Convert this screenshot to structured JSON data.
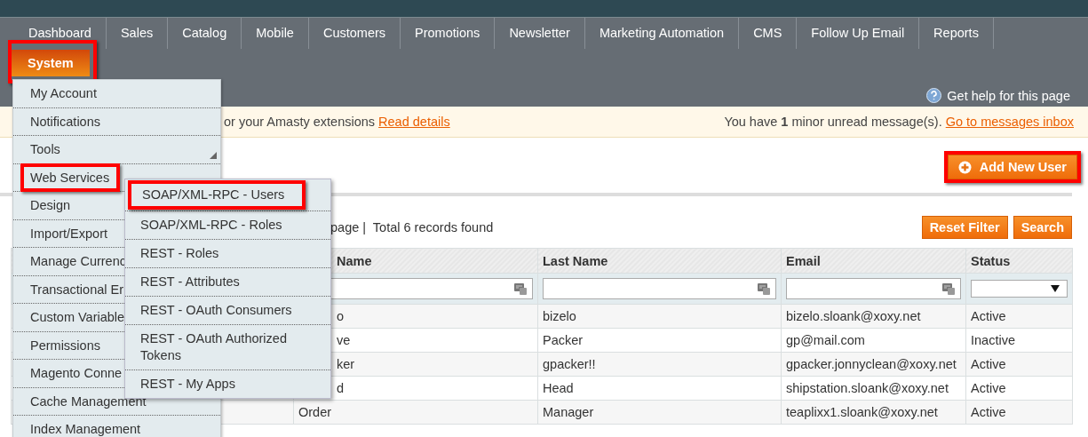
{
  "nav": {
    "items": [
      {
        "label": "Dashboard",
        "selected": false,
        "highlighted": false
      },
      {
        "label": "Sales",
        "selected": false,
        "highlighted": false
      },
      {
        "label": "Catalog",
        "selected": false,
        "highlighted": false
      },
      {
        "label": "Mobile",
        "selected": false,
        "highlighted": false
      },
      {
        "label": "Customers",
        "selected": false,
        "highlighted": false
      },
      {
        "label": "Promotions",
        "selected": false,
        "highlighted": false
      },
      {
        "label": "Newsletter",
        "selected": false,
        "highlighted": false
      },
      {
        "label": "Marketing Automation",
        "selected": false,
        "highlighted": false
      },
      {
        "label": "CMS",
        "selected": false,
        "highlighted": false
      },
      {
        "label": "Follow Up Email",
        "selected": false,
        "highlighted": false
      },
      {
        "label": "Reports",
        "selected": false,
        "highlighted": false
      },
      {
        "label": "System",
        "selected": true,
        "highlighted": true
      }
    ],
    "help": "Get help for this page"
  },
  "notice": {
    "text": "or your Amasty extensions",
    "link": "Read details",
    "message": "You have **1** minor unread message(s).",
    "message_link": "Go to messages inbox"
  },
  "system_menu": [
    {
      "label": "My Account",
      "highlighted": false,
      "has_submenu": false
    },
    {
      "label": "Notifications",
      "highlighted": false,
      "has_submenu": false
    },
    {
      "label": "Tools",
      "highlighted": false,
      "has_submenu": true
    },
    {
      "label": "Web Services",
      "highlighted": true
    },
    {
      "label": "Design",
      "highlighted": false
    },
    {
      "label": "Import/Export",
      "highlighted": false
    },
    {
      "label": "Manage Currenc",
      "highlighted": false
    },
    {
      "label": "Transactional Er",
      "highlighted": false
    },
    {
      "label": "Custom Variable",
      "highlighted": false
    },
    {
      "label": "Permissions",
      "highlighted": false
    },
    {
      "label": "Magento Conne",
      "highlighted": false
    },
    {
      "label": "Cache Management",
      "highlighted": false,
      "has_submenu": false
    },
    {
      "label": "Index Management",
      "highlighted": false,
      "has_submenu": false
    }
  ],
  "web_services_menu": [
    {
      "label": "SOAP/XML-RPC - Users",
      "highlighted": true
    },
    {
      "label": "SOAP/XML-RPC - Roles",
      "highlighted": false
    },
    {
      "label": "REST - Roles",
      "highlighted": false
    },
    {
      "label": "REST - Attributes",
      "highlighted": false
    },
    {
      "label": "REST - OAuth Consumers",
      "highlighted": false
    },
    {
      "label": "REST - OAuth Authorized Tokens",
      "highlighted": false
    },
    {
      "label": "REST - My Apps",
      "highlighted": false
    }
  ],
  "add_button": {
    "label": "Add New User",
    "highlighted": true
  },
  "pager": {
    "text": "page |  Total 6 records found"
  },
  "filter_buttons": [
    "Reset Filter",
    "Search"
  ],
  "table": {
    "columns": [
      "",
      "Name",
      "Last Name",
      "Email",
      "Status"
    ],
    "filters": [
      {
        "kind": "none"
      },
      {
        "kind": "text"
      },
      {
        "kind": "text"
      },
      {
        "kind": "text"
      },
      {
        "kind": "select"
      }
    ],
    "rows": [
      [
        "",
        "o",
        "bizelo",
        "bizelo.sloank@xoxy.net",
        "Active"
      ],
      [
        "",
        "ve",
        "Packer",
        "gp@mail.com",
        "Inactive"
      ],
      [
        "",
        "ker",
        "gpacker!!",
        "gpacker.jonnyclean@xoxy.net",
        "Active"
      ],
      [
        "",
        "d",
        "Head",
        "shipstation.sloank@xoxy.net",
        "Active"
      ],
      [
        "",
        "Order",
        "Manager",
        "teaplixx1.sloank@xoxy.net",
        "Active"
      ]
    ]
  }
}
